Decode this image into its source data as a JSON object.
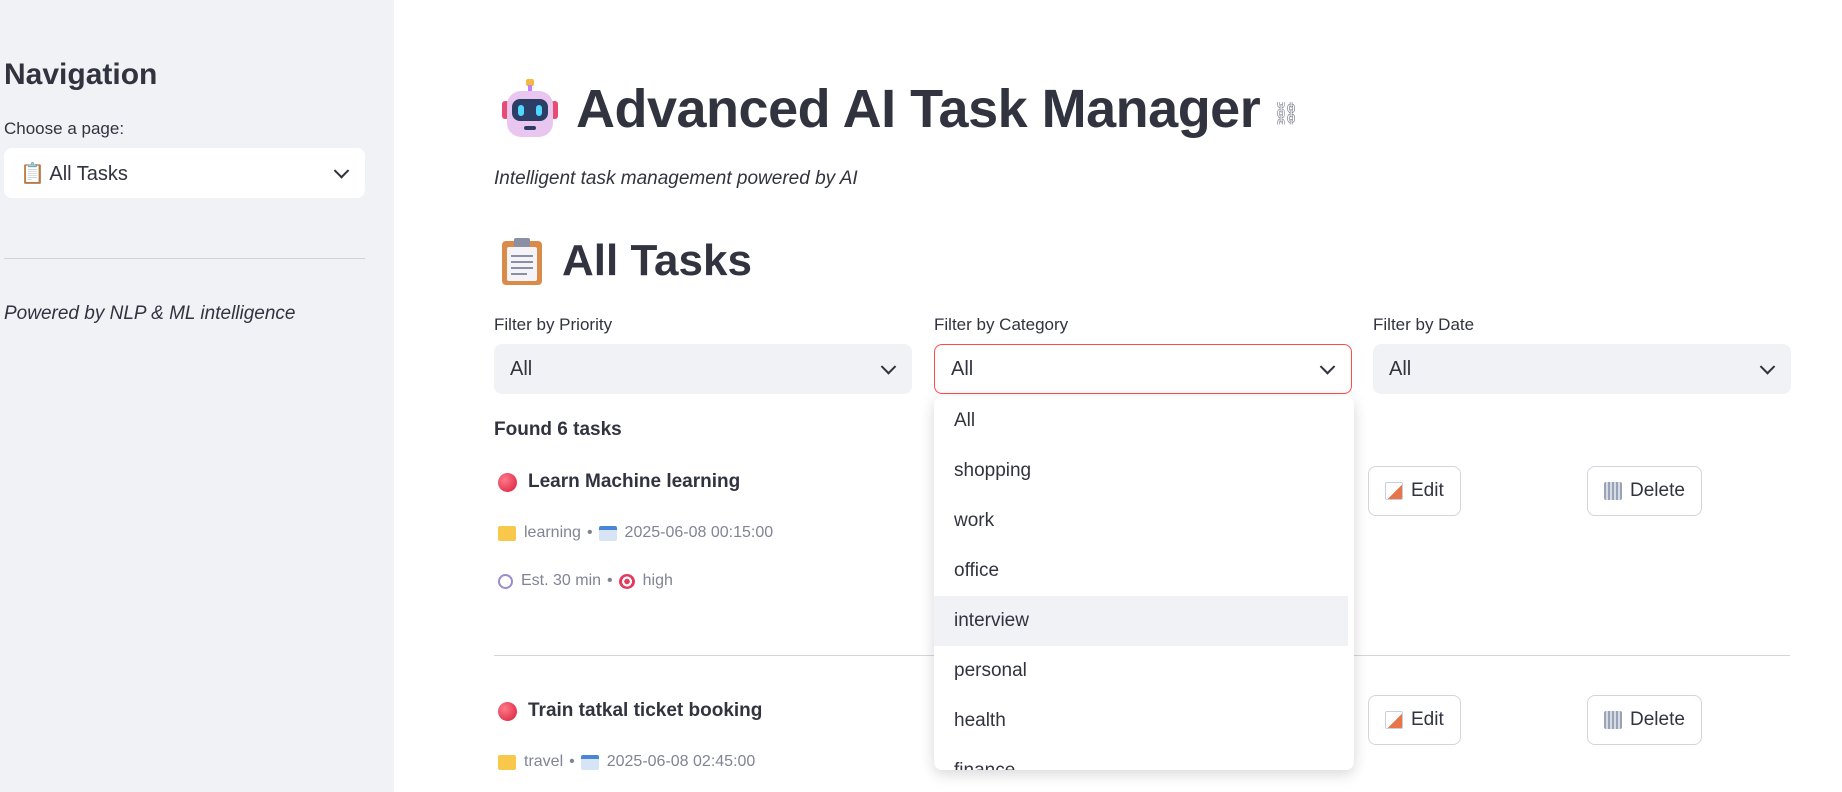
{
  "sidebar": {
    "title": "Navigation",
    "page_label": "Choose a page:",
    "page_value": "📋 All Tasks",
    "caption": "Powered by NLP & ML intelligence"
  },
  "header": {
    "title": "Advanced AI Task Manager",
    "link_icon": "link-icon",
    "subtitle": "Intelligent task management powered by AI"
  },
  "section": {
    "title": "All Tasks"
  },
  "filters": {
    "priority": {
      "label": "Filter by Priority",
      "value": "All"
    },
    "category": {
      "label": "Filter by Category",
      "value": "All"
    },
    "date": {
      "label": "Filter by Date",
      "value": "All"
    }
  },
  "category_dropdown": {
    "options": [
      "All",
      "shopping",
      "work",
      "office",
      "interview",
      "personal",
      "health",
      "finance"
    ],
    "hovered": "interview"
  },
  "results": {
    "found": "Found 6 tasks"
  },
  "tasks": [
    {
      "title": "Learn Machine learning",
      "category": "learning",
      "datetime": "2025-06-08 00:15:00",
      "estimate": "Est. 30 min",
      "priority": "high",
      "edit_label": "Edit",
      "delete_label": "Delete"
    },
    {
      "title": "Train tatkal ticket booking",
      "category": "travel",
      "datetime": "2025-06-08 02:45:00",
      "edit_label": "Edit",
      "delete_label": "Delete"
    }
  ],
  "separator": "•",
  "colors": {
    "accent": "#ff4b4b",
    "sidebar_bg": "#f0f2f6",
    "text": "#31333f",
    "muted": "#808495"
  }
}
